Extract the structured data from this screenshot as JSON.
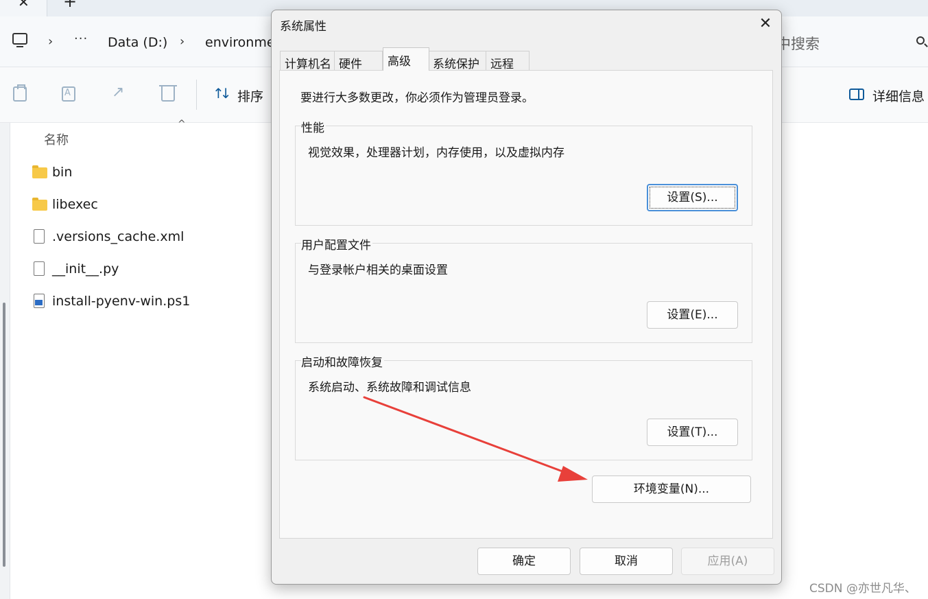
{
  "explorer": {
    "tab_close": "✕",
    "tab_new": "+",
    "breadcrumb": {
      "sep": "›",
      "more": "···",
      "drive": "Data (D:)",
      "folder": "environme"
    },
    "search_placeholder": "中搜索",
    "toolbar": {
      "sort_label": "排序",
      "details_label": "详细信息"
    },
    "column_name": "名称",
    "column_sort_indicator": "^",
    "files": [
      {
        "name": "bin",
        "type": "folder"
      },
      {
        "name": "libexec",
        "type": "folder"
      },
      {
        "name": ".versions_cache.xml",
        "type": "file"
      },
      {
        "name": "__init__.py",
        "type": "file"
      },
      {
        "name": "install-pyenv-win.ps1",
        "type": "powershell"
      }
    ]
  },
  "dialog": {
    "title": "系统属性",
    "close": "✕",
    "tabs": [
      {
        "label": "计算机名",
        "active": false
      },
      {
        "label": "硬件",
        "active": false
      },
      {
        "label": "高级",
        "active": true
      },
      {
        "label": "系统保护",
        "active": false
      },
      {
        "label": "远程",
        "active": false
      }
    ],
    "admin_notice": "要进行大多数更改，你必须作为管理员登录。",
    "groups": [
      {
        "title": "性能",
        "description": "视觉效果，处理器计划，内存使用，以及虚拟内存",
        "button": "设置(S)..."
      },
      {
        "title": "用户配置文件",
        "description": "与登录帐户相关的桌面设置",
        "button": "设置(E)..."
      },
      {
        "title": "启动和故障恢复",
        "description": "系统启动、系统故障和调试信息",
        "button": "设置(T)..."
      }
    ],
    "env_button": "环境变量(N)...",
    "ok_button": "确定",
    "cancel_button": "取消",
    "apply_button": "应用(A)"
  },
  "annotation_color": "#e8403a",
  "watermark": "CSDN @亦世凡华、"
}
